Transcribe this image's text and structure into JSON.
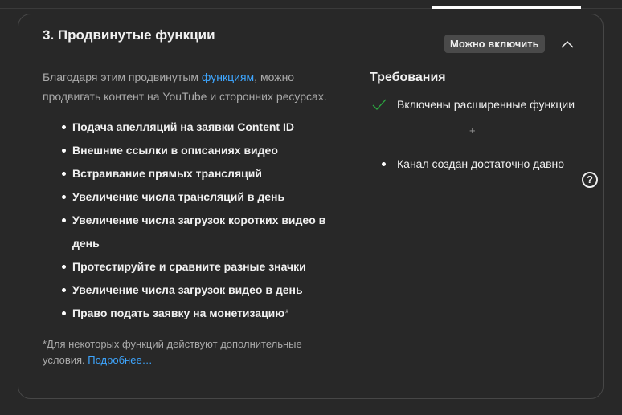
{
  "section": {
    "title": "3. Продвинутые функции",
    "badge": "Можно включить"
  },
  "description": {
    "before": "Благодаря этим продвинутым ",
    "link": "функциям",
    "after": ", можно продвигать контент на YouTube и сторонних ресурсах."
  },
  "features": [
    "Подача апелляций на заявки Content ID",
    "Внешние ссылки в описаниях видео",
    "Встраивание прямых трансляций",
    "Увеличение числа трансляций в день",
    "Увеличение числа загрузок коротких видео в день",
    "Протестируйте и сравните разные значки",
    "Увеличение числа загрузок видео в день",
    "Право подать заявку на монетизацию"
  ],
  "feature_star": "*",
  "footnote": {
    "text": "*Для некоторых функций действуют дополнительные условия. ",
    "link": "Подробнее…"
  },
  "requirements": {
    "title": "Требования",
    "items": [
      {
        "label": "Включены расширенные функции",
        "status": "done"
      },
      {
        "label": "Канал создан достаточно давно",
        "status": "pending"
      }
    ],
    "separator": "+",
    "help": "?"
  },
  "colors": {
    "accent": "#3ea6ff",
    "check": "#2ba640"
  }
}
